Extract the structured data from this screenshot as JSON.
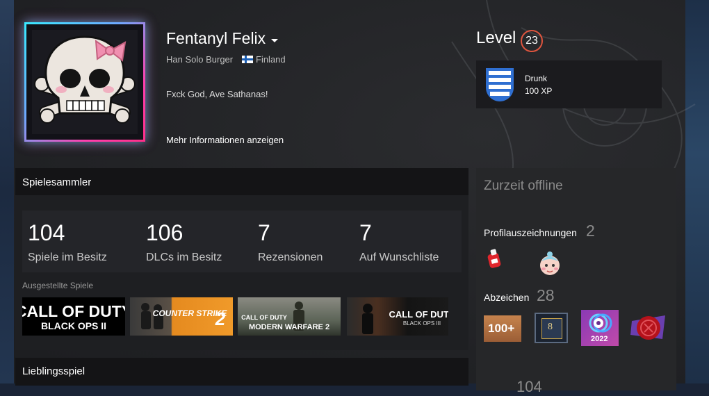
{
  "profile": {
    "persona_name": "Fentanyl Felix",
    "real_name": "Han Solo Burger",
    "country": "Finland",
    "summary": "Fxck God, Ave Sathanas!",
    "more_info": "Mehr Informationen anzeigen"
  },
  "level": {
    "label": "Level",
    "value": "23",
    "badge_name": "Drunk",
    "badge_xp": "100 XP"
  },
  "showcase": {
    "title": "Spielesammler",
    "stats": [
      {
        "value": "104",
        "label": "Spiele im Besitz"
      },
      {
        "value": "106",
        "label": "DLCs im Besitz"
      },
      {
        "value": "7",
        "label": "Rezensionen"
      },
      {
        "value": "7",
        "label": "Auf Wunschliste"
      }
    ],
    "featured_label": "Ausgestellte Spiele",
    "games": [
      {
        "title": "Call of Duty: Black Ops II",
        "logo_top": "CALL OF DUTY",
        "logo_bottom": "BLACK OPS II"
      },
      {
        "title": "Counter-Strike 2",
        "logo_top": "COUNTER STRIKE",
        "logo_bottom": "2"
      },
      {
        "title": "Call of Duty: Modern Warfare 2",
        "logo_top": "CALL OF DUTY",
        "logo_bottom": "MODERN WARFARE 2"
      },
      {
        "title": "Call of Duty: Black Ops III",
        "logo_top": "CALL OF DUTY",
        "logo_bottom": "BLACK OPS III"
      }
    ]
  },
  "favorite": {
    "title": "Lieblingsspiel"
  },
  "side": {
    "status": "Zurzeit offline",
    "awards_label": "Profilauszeichnungen",
    "awards_count": "2",
    "badges_label": "Abzeichen",
    "badges_count": "28",
    "badge_100_text": "100+",
    "badge_8_text": "8",
    "badge_2022_text": "2022",
    "partial_number": "104"
  },
  "colors": {
    "level_ring": "#e0553e",
    "avatar_glow_cyan": "#39e8ff",
    "avatar_glow_pink": "#ff3fae"
  }
}
